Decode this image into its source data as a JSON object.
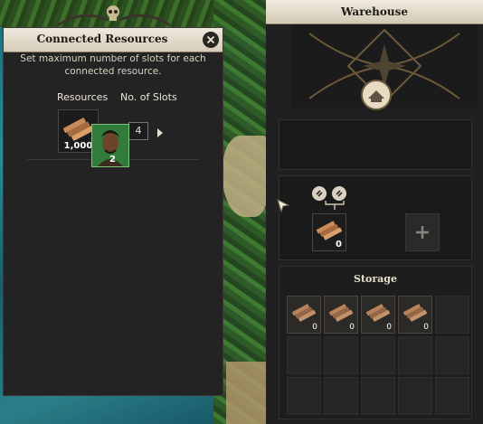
{
  "connected_resources": {
    "title": "Connected Resources",
    "subtitle": "Set maximum number of slots for each connected resource.",
    "col_resources": "Resources",
    "col_slots": "No. of Slots",
    "resource": {
      "icon": "wooden-planks-icon",
      "count": "1,000"
    },
    "slots_value": "4"
  },
  "warehouse": {
    "title": "Warehouse",
    "worker": {
      "icon": "worker-portrait",
      "count": "2"
    },
    "connection": {
      "slot_count": "0",
      "add_icon": "plus-icon"
    },
    "storage": {
      "title": "Storage",
      "filled_counts": [
        "0",
        "0",
        "0",
        "0"
      ],
      "total_cells": 15
    }
  },
  "colors": {
    "panel_bg": "#232323",
    "title_bar": "#e6dfcf",
    "worker_border": "#7fc27c",
    "wood": "#c98a55"
  }
}
